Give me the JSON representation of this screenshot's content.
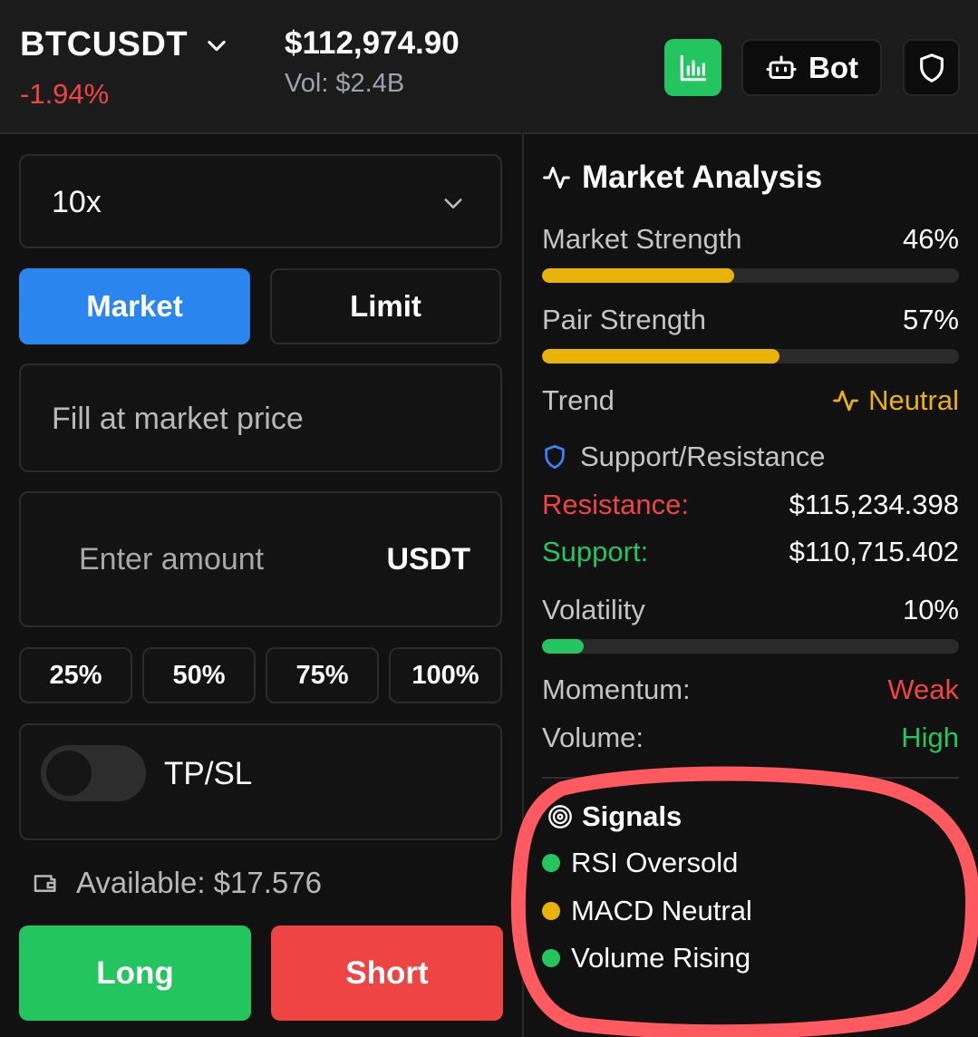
{
  "header": {
    "pair": "BTCUSDT",
    "change": "-1.94%",
    "price": "$112,974.90",
    "volume": "Vol: $2.4B",
    "bot_label": "Bot"
  },
  "order": {
    "leverage": "10x",
    "tabs": {
      "market": "Market",
      "limit": "Limit"
    },
    "fill_text": "Fill at market price",
    "amount_placeholder": "Enter amount",
    "amount_unit": "USDT",
    "percents": [
      "25%",
      "50%",
      "75%",
      "100%"
    ],
    "tpsl_label": "TP/SL",
    "available": "Available: $17.576",
    "long_label": "Long",
    "short_label": "Short"
  },
  "analysis": {
    "title": "Market Analysis",
    "market_strength": {
      "label": "Market Strength",
      "value": "46%",
      "fraction": 0.46
    },
    "pair_strength": {
      "label": "Pair Strength",
      "value": "57%",
      "fraction": 0.57
    },
    "trend": {
      "label": "Trend",
      "value": "Neutral"
    },
    "sr_title": "Support/Resistance",
    "resistance": {
      "label": "Resistance:",
      "value": "$115,234.398"
    },
    "support": {
      "label": "Support:",
      "value": "$110,715.402"
    },
    "volatility": {
      "label": "Volatility",
      "value": "10%",
      "fraction": 0.1
    },
    "momentum": {
      "label": "Momentum:",
      "value": "Weak"
    },
    "volume": {
      "label": "Volume:",
      "value": "High"
    },
    "signals_title": "Signals",
    "signals": [
      "RSI Oversold",
      "MACD Neutral",
      "Volume Rising"
    ]
  },
  "colors": {
    "green": "#22c55e",
    "red": "#ef4444",
    "yellow": "#eab308",
    "blue": "#2a86ee",
    "annotation": "#ff5a5f"
  }
}
